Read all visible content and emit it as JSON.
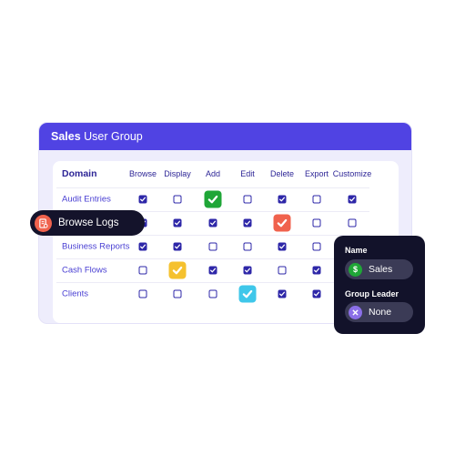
{
  "window": {
    "title_bold": "Sales",
    "title_rest": "User Group"
  },
  "table": {
    "domain_header": "Domain",
    "columns": [
      "Browse",
      "Display",
      "Add",
      "Edit",
      "Delete",
      "Export",
      "Customize"
    ],
    "rows": [
      {
        "label": "Audit Entries",
        "checks": [
          true,
          false,
          true,
          false,
          true,
          false,
          true
        ]
      },
      {
        "label": "Browse Logs",
        "checks": [
          true,
          true,
          true,
          true,
          true,
          false,
          false
        ]
      },
      {
        "label": "Business Reports",
        "checks": [
          true,
          true,
          false,
          false,
          true,
          false,
          false
        ]
      },
      {
        "label": "Cash Flows",
        "checks": [
          false,
          true,
          true,
          true,
          false,
          true,
          false
        ]
      },
      {
        "label": "Clients",
        "checks": [
          false,
          false,
          false,
          true,
          true,
          true,
          false
        ]
      }
    ]
  },
  "highlight_pill": {
    "label": "Browse Logs",
    "icon": "report-icon",
    "color": "#f0624d"
  },
  "highlighted_checks": [
    {
      "row": 0,
      "col": 2,
      "color": "#1fa637",
      "icon": "check-icon"
    },
    {
      "row": 1,
      "col": 4,
      "color": "#f0624d",
      "icon": "check-icon"
    },
    {
      "row": 3,
      "col": 1,
      "color": "#f5c12e",
      "icon": "check-icon"
    },
    {
      "row": 4,
      "col": 3,
      "color": "#3fc7ea",
      "icon": "check-icon"
    }
  ],
  "details_card": {
    "name_label": "Name",
    "name_value": "Sales",
    "name_icon": "dollar-icon",
    "name_icon_color": "#1fa637",
    "leader_label": "Group Leader",
    "leader_value": "None",
    "leader_icon": "close-icon",
    "leader_icon_color": "#8b6fe8"
  },
  "colors": {
    "accent": "#5043e3",
    "checkbox": "#2e27a8",
    "dark": "#12122a"
  }
}
